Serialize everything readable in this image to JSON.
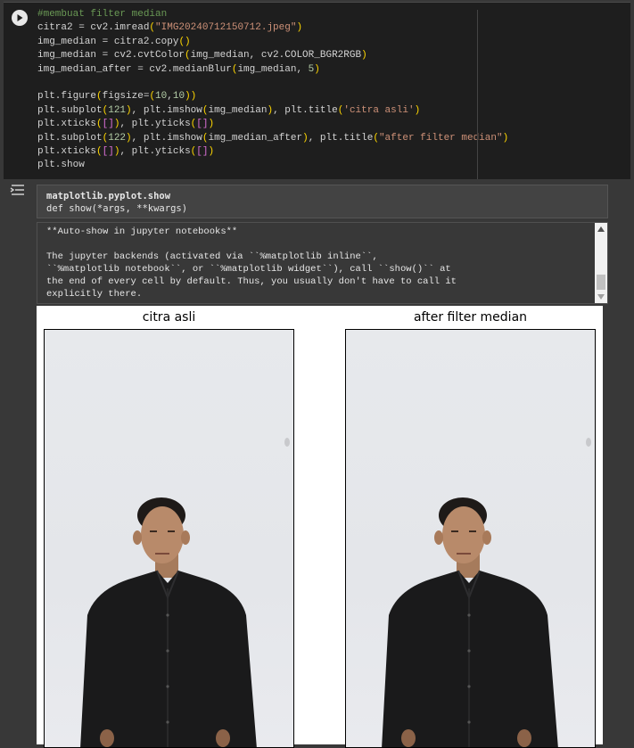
{
  "code_cell": {
    "run_icon": "play-icon",
    "lines": [
      "#membuat filter median",
      "citra2 = cv2.imread(\"IMG20240712150712.jpeg\")",
      "img_median = citra2.copy()",
      "img_median = cv2.cvtColor(img_median, cv2.COLOR_BGR2RGB)",
      "img_median_after = cv2.medianBlur(img_median, 5)",
      "",
      "plt.figure(figsize=(10,10))",
      "plt.subplot(121), plt.imshow(img_median), plt.title('citra asli')",
      "plt.xticks([]), plt.yticks([])",
      "plt.subplot(122), plt.imshow(img_median_after), plt.title(\"after filter median\")",
      "plt.xticks([]), plt.yticks([])",
      "plt.show"
    ]
  },
  "output": {
    "output_icon": "output-toggle-icon",
    "doc_signature_name": "matplotlib.pyplot.show",
    "doc_signature_def": "def show(*args, **kwargs)",
    "doc_text": "**Auto-show in jupyter notebooks**\n\nThe jupyter backends (activated via ``%matplotlib inline``,\n``%matplotlib notebook``, or ``%matplotlib widget``), call ``show()`` at\nthe end of every cell by default. Thus, you usually don't have to call it\nexplicitly there."
  },
  "figure": {
    "left_title": "citra asli",
    "right_title": "after filter median"
  },
  "colors": {
    "cell_bg": "#1e1e1e",
    "page_bg": "#383838",
    "comment": "#6a9955",
    "string": "#ce9178"
  }
}
